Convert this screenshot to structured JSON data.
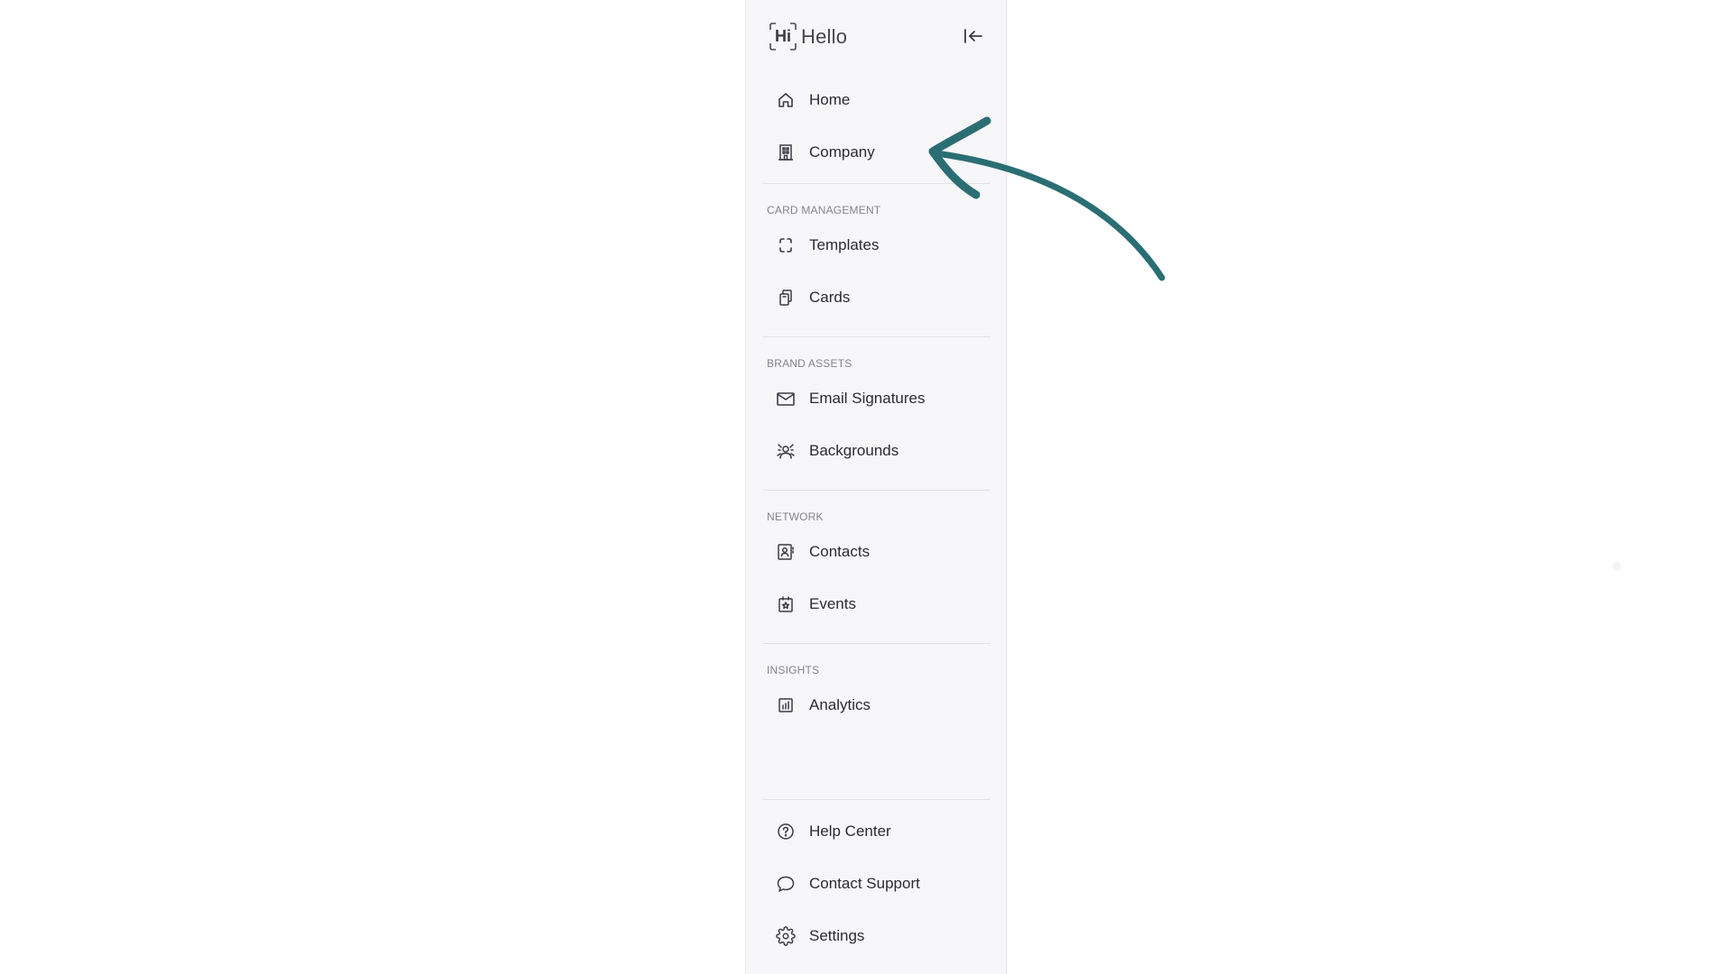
{
  "app": {
    "logo_mark": "Hi",
    "logo_text": "Hello"
  },
  "nav": {
    "top": [
      {
        "label": "Home",
        "icon": "home-icon"
      },
      {
        "label": "Company",
        "icon": "building-icon"
      }
    ],
    "card_management": {
      "title": "CARD MANAGEMENT",
      "items": [
        {
          "label": "Templates",
          "icon": "template-icon"
        },
        {
          "label": "Cards",
          "icon": "cards-icon"
        }
      ]
    },
    "brand_assets": {
      "title": "BRAND ASSETS",
      "items": [
        {
          "label": "Email Signatures",
          "icon": "mail-icon"
        },
        {
          "label": "Backgrounds",
          "icon": "background-icon"
        }
      ]
    },
    "network": {
      "title": "NETWORK",
      "items": [
        {
          "label": "Contacts",
          "icon": "contacts-icon"
        },
        {
          "label": "Events",
          "icon": "calendar-star-icon"
        }
      ]
    },
    "insights": {
      "title": "INSIGHTS",
      "items": [
        {
          "label": "Analytics",
          "icon": "analytics-icon"
        }
      ]
    },
    "bottom": [
      {
        "label": "Help Center",
        "icon": "help-icon"
      },
      {
        "label": "Contact Support",
        "icon": "chat-bubble-icon"
      },
      {
        "label": "Settings",
        "icon": "gear-icon"
      }
    ]
  },
  "colors": {
    "sidebar_bg": "#f7f6f9",
    "arrow": "#2a6e74"
  }
}
